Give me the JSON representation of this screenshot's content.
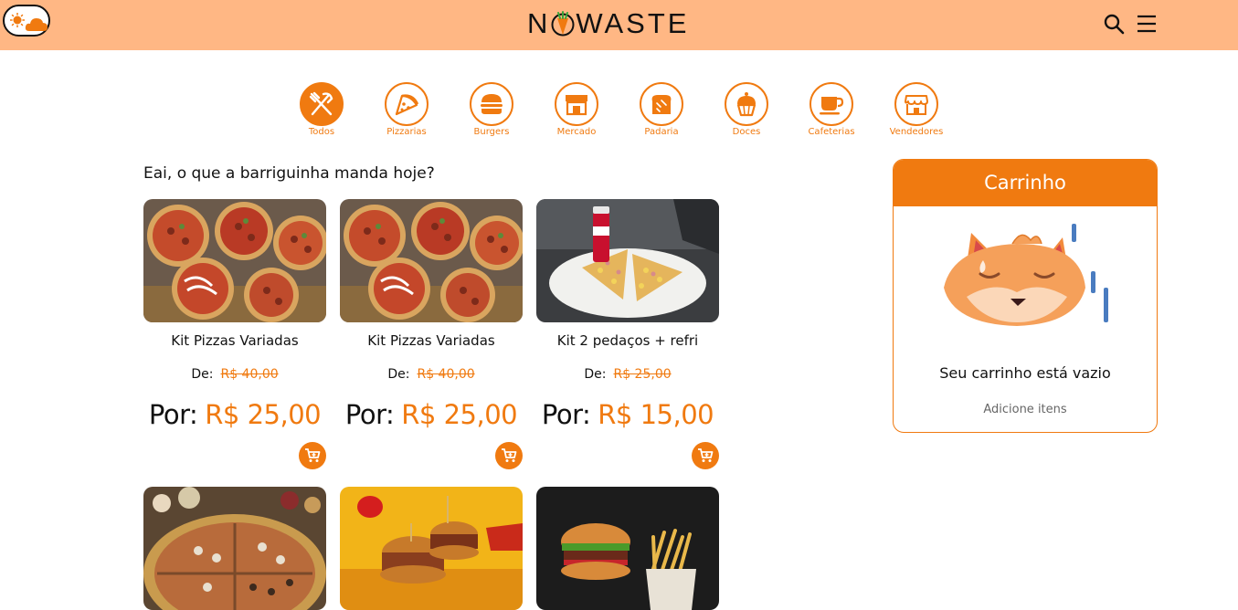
{
  "header": {
    "logo_text": "NOWASTE",
    "logo_prefix": "N",
    "logo_suffix": "WASTE",
    "brand_color": "#f07a10",
    "bar_color": "#ffb784"
  },
  "categories": [
    {
      "label": "Todos",
      "icon": "cutlery-icon",
      "active": true
    },
    {
      "label": "Pizzarias",
      "icon": "pizza-icon",
      "active": false
    },
    {
      "label": "Burgers",
      "icon": "burger-icon",
      "active": false
    },
    {
      "label": "Mercado",
      "icon": "store-icon",
      "active": false
    },
    {
      "label": "Padaria",
      "icon": "bread-icon",
      "active": false
    },
    {
      "label": "Doces",
      "icon": "cupcake-icon",
      "active": false
    },
    {
      "label": "Cafeterias",
      "icon": "coffee-icon",
      "active": false
    },
    {
      "label": "Vendedores",
      "icon": "shop-icon",
      "active": false
    }
  ],
  "main": {
    "greeting": "Eai, o que a barriguinha manda hoje?",
    "de_label": "De:",
    "por_label": "Por:",
    "products": [
      {
        "name": "Kit Pizzas Variadas",
        "old_price": "R$ 40,00",
        "price": "R$ 25,00",
        "image": "pizzas-photo"
      },
      {
        "name": "Kit Pizzas Variadas",
        "old_price": "R$ 40,00",
        "price": "R$ 25,00",
        "image": "pizzas-photo"
      },
      {
        "name": "Kit 2 pedaços + refri",
        "old_price": "R$ 25,00",
        "price": "R$ 15,00",
        "image": "pizza-slices-soda-photo"
      }
    ],
    "products_row2": [
      {
        "image": "large-pizza-photo"
      },
      {
        "image": "burgers-photo"
      },
      {
        "image": "burger-fries-photo"
      }
    ]
  },
  "cart": {
    "title": "Carrinho",
    "empty_text": "Seu carrinho está vazio",
    "hint": "Adicione itens"
  }
}
